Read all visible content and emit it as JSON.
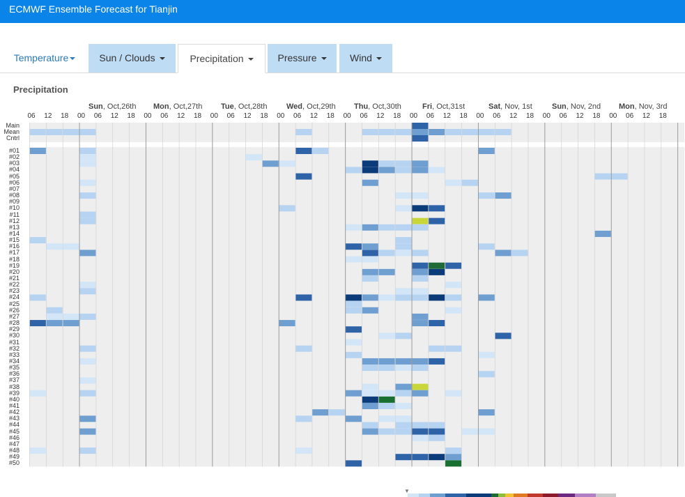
{
  "header": {
    "title": "ECMWF Ensemble Forecast for Tianjin"
  },
  "tabs": [
    {
      "label": "Temperature",
      "style": "plain"
    },
    {
      "label": "Sun / Clouds",
      "style": "blue"
    },
    {
      "label": "Precipitation",
      "style": "active"
    },
    {
      "label": "Pressure",
      "style": "blue"
    },
    {
      "label": "Wind",
      "style": "blue"
    }
  ],
  "section": {
    "title": "Precipitation"
  },
  "days": [
    {
      "weekday": "Sun",
      "date": "Oct,26th"
    },
    {
      "weekday": "Mon",
      "date": "Oct,27th"
    },
    {
      "weekday": "Tue",
      "date": "Oct,28th"
    },
    {
      "weekday": "Wed",
      "date": "Oct,29th"
    },
    {
      "weekday": "Thu",
      "date": "Oct,30th"
    },
    {
      "weekday": "Fri",
      "date": "Oct,31st"
    },
    {
      "weekday": "Sat",
      "date": "Nov, 1st"
    },
    {
      "weekday": "Sun",
      "date": "Nov, 2nd"
    },
    {
      "weekday": "Mon",
      "date": "Nov, 3rd"
    }
  ],
  "hours": [
    "06",
    "12",
    "18",
    "00",
    "06",
    "12",
    "18",
    "00",
    "06",
    "12",
    "18",
    "00",
    "06",
    "12",
    "18",
    "00",
    "06",
    "12",
    "18",
    "00",
    "06",
    "12",
    "18",
    "00",
    "06",
    "12",
    "18",
    "00",
    "06",
    "12",
    "18",
    "00",
    "06",
    "12",
    "18",
    "00",
    "06",
    "12",
    "18"
  ],
  "row_labels": [
    "Main",
    "Mean",
    "Cntrl",
    "#01",
    "#02",
    "#03",
    "#04",
    "#05",
    "#06",
    "#07",
    "#08",
    "#09",
    "#10",
    "#11",
    "#12",
    "#13",
    "#14",
    "#15",
    "#16",
    "#17",
    "#18",
    "#19",
    "#20",
    "#21",
    "#22",
    "#23",
    "#24",
    "#25",
    "#26",
    "#27",
    "#28",
    "#29",
    "#30",
    "#31",
    "#32",
    "#33",
    "#34",
    "#35",
    "#36",
    "#37",
    "#38",
    "#39",
    "#40",
    "#41",
    "#42",
    "#43",
    "#44",
    "#45",
    "#46",
    "#47",
    "#48",
    "#49",
    "#50"
  ],
  "colors": {
    "topbar": "#0a84e8",
    "tab_blue": "#bfdcf5",
    "grid_bg": "#eeeeee",
    "levels": [
      "#d2e6f8",
      "#b6d4f2",
      "#6f9fd0",
      "#2f63a8",
      "#0b3b78",
      "#c8d63a",
      "#8ebf3a",
      "#1e6b35",
      "#196f2f"
    ]
  },
  "chart_data": {
    "type": "heatmap",
    "title": "Precipitation",
    "x_start": "06",
    "x_step_hours": 6,
    "rows": [
      "Main",
      "Mean",
      "Cntrl",
      "#01",
      "#02",
      "#03",
      "#04",
      "#05",
      "#06",
      "#07",
      "#08",
      "#09",
      "#10",
      "#11",
      "#12",
      "#13",
      "#14",
      "#15",
      "#16",
      "#17",
      "#18",
      "#19",
      "#20",
      "#21",
      "#22",
      "#23",
      "#24",
      "#25",
      "#26",
      "#27",
      "#28",
      "#29",
      "#30",
      "#31",
      "#32",
      "#33",
      "#34",
      "#35",
      "#36",
      "#37",
      "#38",
      "#39",
      "#40",
      "#41",
      "#42",
      "#43",
      "#44",
      "#45",
      "#46",
      "#47",
      "#48",
      "#49",
      "#50"
    ],
    "cells": [
      [
        0,
        23,
        3
      ],
      [
        1,
        0,
        1
      ],
      [
        1,
        1,
        1
      ],
      [
        1,
        2,
        1
      ],
      [
        1,
        3,
        1
      ],
      [
        1,
        16,
        1
      ],
      [
        1,
        20,
        1
      ],
      [
        1,
        21,
        1
      ],
      [
        1,
        22,
        1
      ],
      [
        1,
        23,
        2
      ],
      [
        1,
        24,
        2
      ],
      [
        1,
        25,
        1
      ],
      [
        1,
        26,
        1
      ],
      [
        1,
        27,
        1
      ],
      [
        1,
        28,
        1
      ],
      [
        2,
        23,
        3
      ],
      [
        3,
        0,
        2
      ],
      [
        3,
        3,
        1
      ],
      [
        3,
        16,
        3
      ],
      [
        3,
        17,
        1
      ],
      [
        3,
        27,
        2
      ],
      [
        4,
        3,
        0
      ],
      [
        4,
        13,
        0
      ],
      [
        5,
        3,
        0
      ],
      [
        5,
        14,
        2
      ],
      [
        5,
        15,
        0
      ],
      [
        5,
        20,
        4
      ],
      [
        5,
        21,
        1
      ],
      [
        5,
        22,
        1
      ],
      [
        5,
        23,
        2
      ],
      [
        6,
        19,
        1
      ],
      [
        6,
        20,
        4
      ],
      [
        6,
        21,
        2
      ],
      [
        6,
        22,
        1
      ],
      [
        6,
        23,
        2
      ],
      [
        6,
        24,
        0
      ],
      [
        7,
        16,
        3
      ],
      [
        7,
        34,
        1
      ],
      [
        7,
        35,
        1
      ],
      [
        8,
        3,
        0
      ],
      [
        8,
        20,
        2
      ],
      [
        8,
        25,
        0
      ],
      [
        8,
        26,
        1
      ],
      [
        10,
        3,
        1
      ],
      [
        10,
        22,
        0
      ],
      [
        10,
        23,
        0
      ],
      [
        10,
        27,
        1
      ],
      [
        10,
        28,
        2
      ],
      [
        12,
        15,
        1
      ],
      [
        12,
        22,
        0
      ],
      [
        12,
        23,
        4
      ],
      [
        12,
        24,
        3
      ],
      [
        13,
        3,
        1
      ],
      [
        14,
        3,
        1
      ],
      [
        14,
        23,
        5
      ],
      [
        14,
        24,
        3
      ],
      [
        15,
        19,
        0
      ],
      [
        15,
        20,
        2
      ],
      [
        15,
        21,
        1
      ],
      [
        15,
        22,
        1
      ],
      [
        15,
        23,
        1
      ],
      [
        16,
        34,
        2
      ],
      [
        17,
        0,
        1
      ],
      [
        17,
        22,
        1
      ],
      [
        18,
        1,
        0
      ],
      [
        18,
        2,
        0
      ],
      [
        18,
        19,
        3
      ],
      [
        18,
        20,
        2
      ],
      [
        18,
        22,
        1
      ],
      [
        18,
        27,
        1
      ],
      [
        19,
        3,
        2
      ],
      [
        19,
        20,
        3
      ],
      [
        19,
        21,
        1
      ],
      [
        19,
        22,
        0
      ],
      [
        19,
        23,
        1
      ],
      [
        19,
        28,
        2
      ],
      [
        19,
        29,
        1
      ],
      [
        20,
        19,
        0
      ],
      [
        20,
        20,
        0
      ],
      [
        21,
        23,
        3
      ],
      [
        21,
        24,
        7
      ],
      [
        21,
        25,
        3
      ],
      [
        22,
        20,
        2
      ],
      [
        22,
        21,
        2
      ],
      [
        22,
        23,
        2
      ],
      [
        22,
        24,
        4
      ],
      [
        23,
        20,
        1
      ],
      [
        23,
        23,
        1
      ],
      [
        24,
        3,
        0
      ],
      [
        24,
        25,
        0
      ],
      [
        25,
        3,
        1
      ],
      [
        25,
        22,
        0
      ],
      [
        25,
        23,
        0
      ],
      [
        26,
        0,
        1
      ],
      [
        26,
        16,
        3
      ],
      [
        26,
        19,
        4
      ],
      [
        26,
        20,
        2
      ],
      [
        26,
        21,
        0
      ],
      [
        26,
        22,
        1
      ],
      [
        26,
        23,
        1
      ],
      [
        26,
        24,
        4
      ],
      [
        26,
        25,
        1
      ],
      [
        26,
        27,
        2
      ],
      [
        27,
        19,
        1
      ],
      [
        28,
        1,
        1
      ],
      [
        28,
        19,
        1
      ],
      [
        28,
        20,
        2
      ],
      [
        28,
        25,
        0
      ],
      [
        29,
        1,
        0
      ],
      [
        29,
        2,
        0
      ],
      [
        29,
        3,
        1
      ],
      [
        29,
        23,
        2
      ],
      [
        30,
        0,
        3
      ],
      [
        30,
        1,
        2
      ],
      [
        30,
        2,
        2
      ],
      [
        30,
        15,
        2
      ],
      [
        30,
        23,
        2
      ],
      [
        30,
        24,
        3
      ],
      [
        31,
        19,
        3
      ],
      [
        32,
        21,
        0
      ],
      [
        32,
        22,
        1
      ],
      [
        32,
        28,
        3
      ],
      [
        33,
        19,
        0
      ],
      [
        34,
        3,
        1
      ],
      [
        34,
        16,
        1
      ],
      [
        34,
        24,
        1
      ],
      [
        34,
        25,
        1
      ],
      [
        35,
        19,
        1
      ],
      [
        35,
        27,
        0
      ],
      [
        36,
        3,
        0
      ],
      [
        36,
        20,
        2
      ],
      [
        36,
        21,
        2
      ],
      [
        36,
        22,
        2
      ],
      [
        36,
        23,
        2
      ],
      [
        36,
        24,
        3
      ],
      [
        37,
        20,
        1
      ],
      [
        37,
        21,
        1
      ],
      [
        37,
        22,
        0
      ],
      [
        37,
        23,
        1
      ],
      [
        38,
        27,
        1
      ],
      [
        39,
        3,
        0
      ],
      [
        40,
        20,
        0
      ],
      [
        40,
        22,
        2
      ],
      [
        40,
        23,
        5
      ],
      [
        41,
        0,
        0
      ],
      [
        41,
        3,
        1
      ],
      [
        41,
        19,
        2
      ],
      [
        41,
        20,
        0
      ],
      [
        41,
        21,
        0
      ],
      [
        41,
        22,
        1
      ],
      [
        41,
        23,
        2
      ],
      [
        41,
        25,
        0
      ],
      [
        42,
        20,
        4
      ],
      [
        42,
        21,
        8
      ],
      [
        43,
        20,
        2
      ],
      [
        43,
        21,
        1
      ],
      [
        43,
        22,
        0
      ],
      [
        44,
        17,
        2
      ],
      [
        44,
        18,
        1
      ],
      [
        44,
        27,
        2
      ],
      [
        45,
        3,
        2
      ],
      [
        45,
        16,
        1
      ],
      [
        45,
        19,
        2
      ],
      [
        45,
        21,
        0
      ],
      [
        45,
        22,
        0
      ],
      [
        46,
        20,
        1
      ],
      [
        46,
        22,
        1
      ],
      [
        46,
        23,
        1
      ],
      [
        46,
        24,
        1
      ],
      [
        47,
        3,
        2
      ],
      [
        47,
        20,
        2
      ],
      [
        47,
        21,
        1
      ],
      [
        47,
        22,
        1
      ],
      [
        47,
        23,
        3
      ],
      [
        47,
        24,
        3
      ],
      [
        47,
        26,
        0
      ],
      [
        47,
        27,
        0
      ],
      [
        48,
        23,
        0
      ],
      [
        48,
        24,
        1
      ],
      [
        50,
        0,
        0
      ],
      [
        50,
        3,
        1
      ],
      [
        50,
        16,
        0
      ],
      [
        50,
        25,
        1
      ],
      [
        51,
        22,
        3
      ],
      [
        51,
        23,
        3
      ],
      [
        51,
        24,
        4
      ],
      [
        51,
        25,
        2
      ],
      [
        52,
        19,
        3
      ],
      [
        52,
        25,
        8
      ]
    ]
  }
}
